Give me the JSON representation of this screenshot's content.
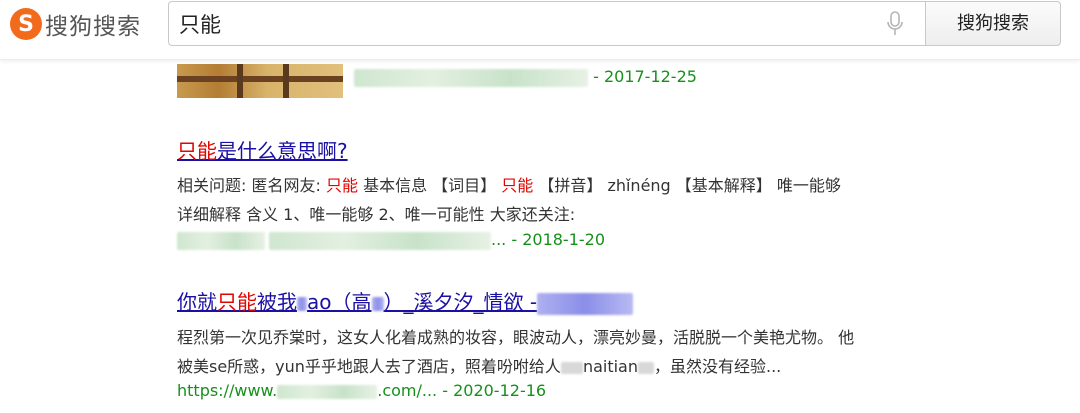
{
  "header": {
    "logo_mark": "S",
    "logo_text": "搜狗搜索",
    "search_value": "只能",
    "search_button": "搜狗搜索"
  },
  "results": [
    {
      "date": "- 2017-12-25"
    },
    {
      "title_hl": "只能",
      "title_rest": "是什么意思啊?",
      "line1_a": "相关问题:  匿名网友: ",
      "line1_hl1": "只能",
      "line1_b": " 基本信息 【词目】 ",
      "line1_hl2": "只能",
      "line1_c": " 【拼音】 zhǐnéng 【基本解释】 唯一能够",
      "line2": "详细解释 含义 1、唯一能够 2、唯一可能性 大家还关注:",
      "cite_tail": "... - 2018-1-20"
    },
    {
      "title_a": "你就",
      "title_hl": "只能",
      "title_b": "被我",
      "title_c": "ao（高",
      "title_d": "）_溪夕汐_情欲 -",
      "line1": "程烈第一次见乔棠时，这女人化着成熟的妆容，眼波动人，漂亮妙曼，活脱脱一个美艳尤物。 他",
      "line2_a": "被美se所惑，yun乎乎地跟人去了酒店，照着吩咐给人",
      "line2_b": "naitian",
      "line2_c": "，虽然没有经验...",
      "url_a": "https://www.",
      "url_b": ".com/... - 2020-12-16"
    }
  ]
}
